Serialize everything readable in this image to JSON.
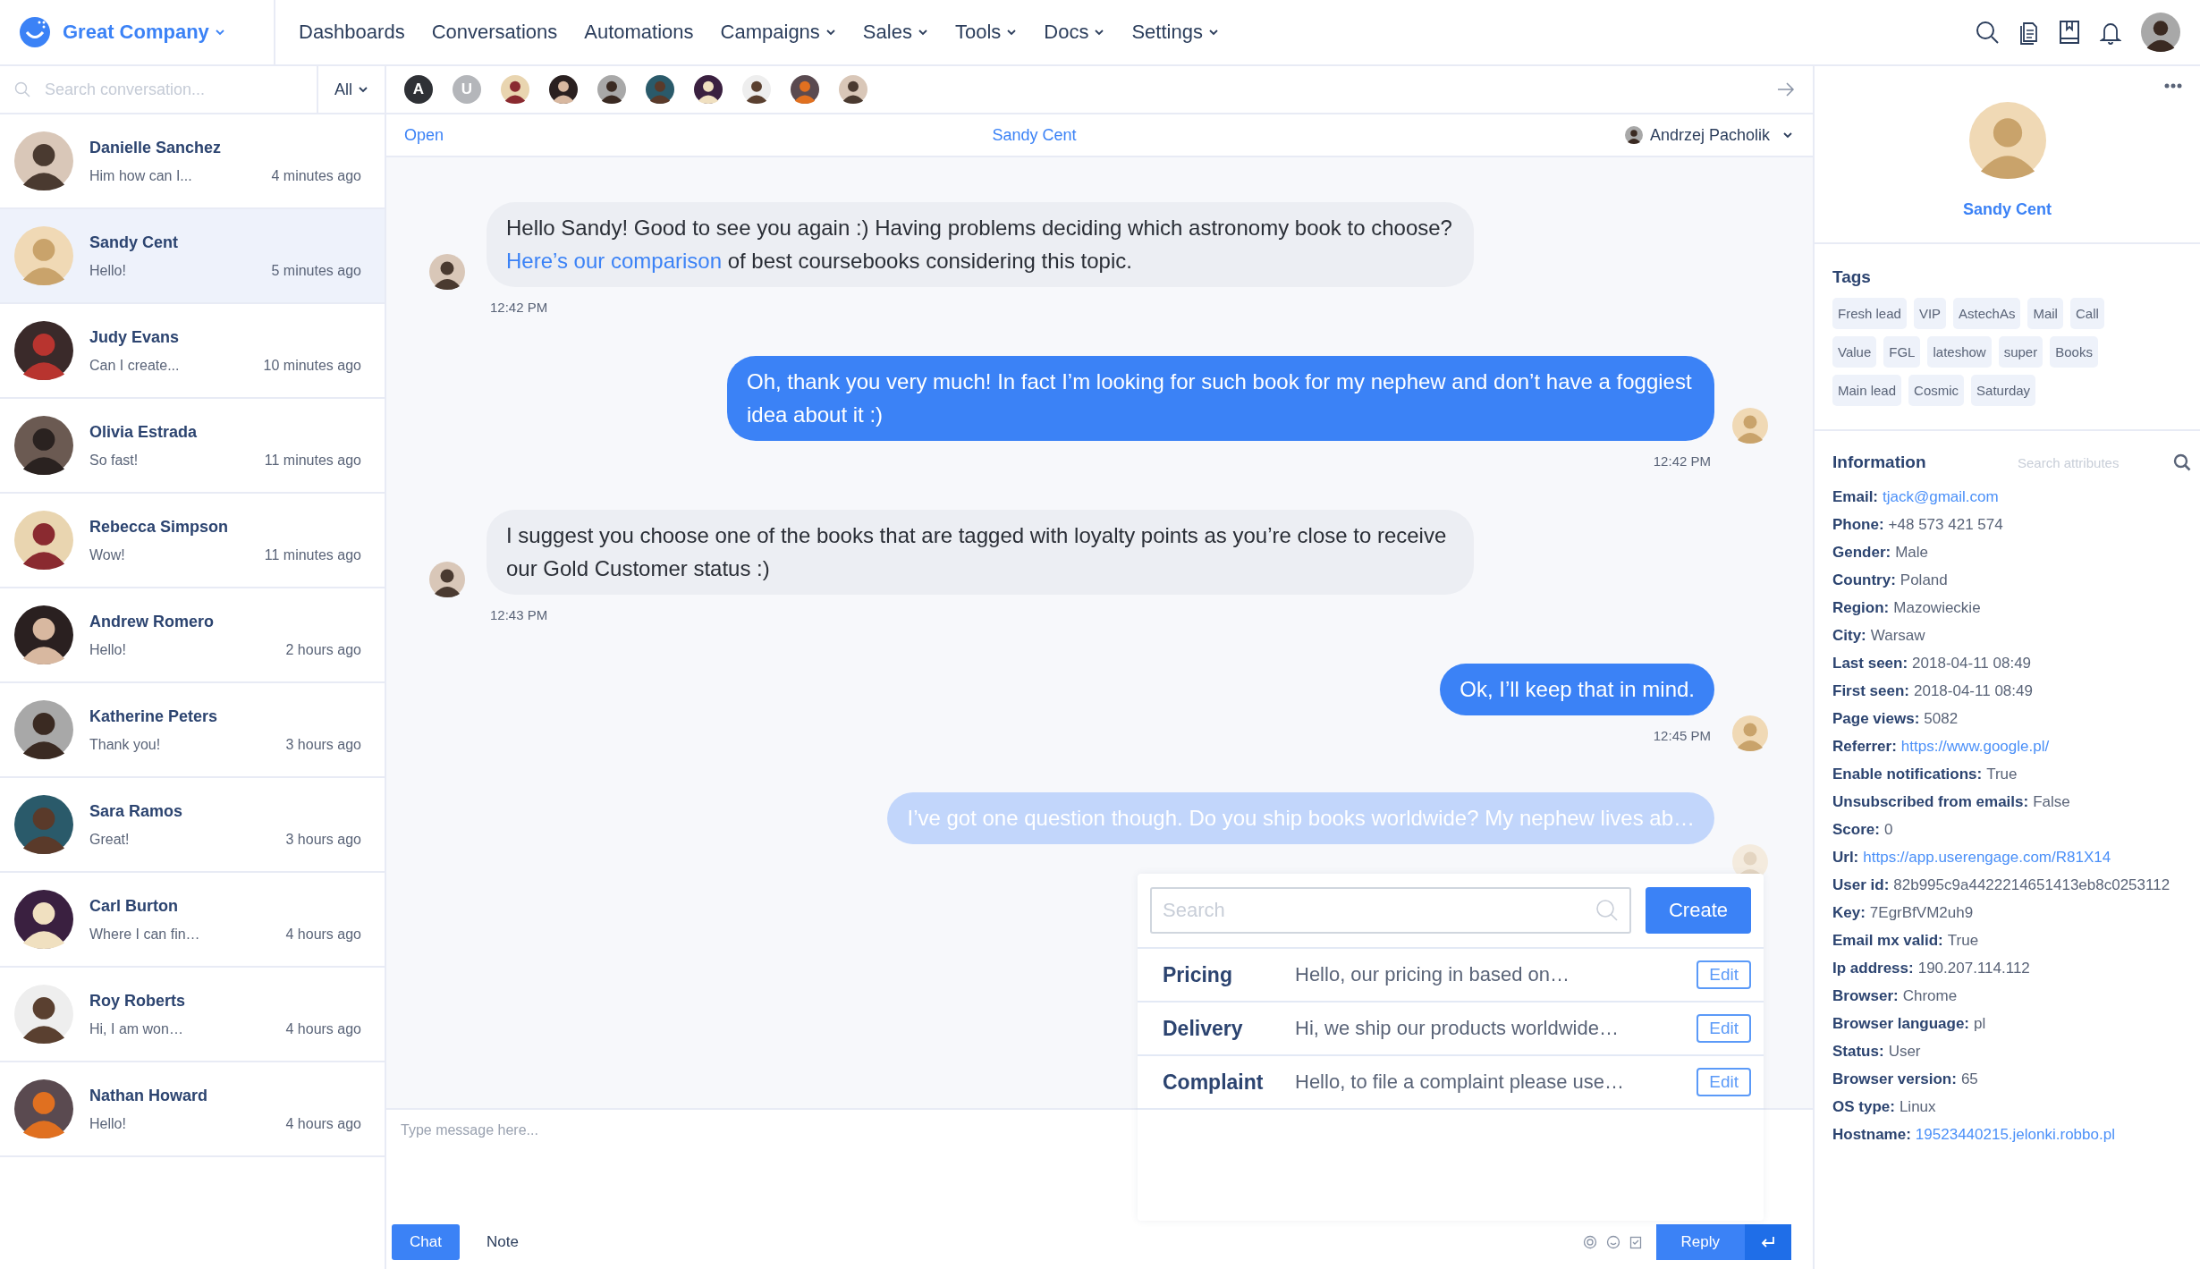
{
  "brand": {
    "name": "Great Company"
  },
  "nav": [
    {
      "label": "Dashboards",
      "dropdown": false
    },
    {
      "label": "Conversations",
      "dropdown": false
    },
    {
      "label": "Automations",
      "dropdown": false
    },
    {
      "label": "Campaigns",
      "dropdown": true
    },
    {
      "label": "Sales",
      "dropdown": true
    },
    {
      "label": "Tools",
      "dropdown": true
    },
    {
      "label": "Docs",
      "dropdown": true
    },
    {
      "label": "Settings",
      "dropdown": true
    }
  ],
  "sidebar": {
    "search": {
      "placeholder": "Search conversation..."
    },
    "filter": "All",
    "conversations": [
      {
        "name": "Danielle Sanchez",
        "preview": "Him how can I...",
        "time": "4 minutes ago",
        "selected": false
      },
      {
        "name": "Sandy Cent",
        "preview": "Hello!",
        "time": "5 minutes ago",
        "selected": true
      },
      {
        "name": "Judy Evans",
        "preview": "Can I create...",
        "time": "10 minutes ago",
        "selected": false
      },
      {
        "name": "Olivia Estrada",
        "preview": "So fast!",
        "time": "11 minutes ago",
        "selected": false
      },
      {
        "name": "Rebecca Simpson",
        "preview": "Wow!",
        "time": "11 minutes ago",
        "selected": false
      },
      {
        "name": "Andrew Romero",
        "preview": "Hello!",
        "time": "2 hours ago",
        "selected": false
      },
      {
        "name": "Katherine Peters",
        "preview": "Thank you!",
        "time": "3 hours ago",
        "selected": false
      },
      {
        "name": "Sara Ramos",
        "preview": "Great!",
        "time": "3 hours ago",
        "selected": false
      },
      {
        "name": "Carl Burton",
        "preview": "Where I can fin…",
        "time": "4 hours ago",
        "selected": false
      },
      {
        "name": "Roy Roberts",
        "preview": "Hi, I am won…",
        "time": "4 hours ago",
        "selected": false
      },
      {
        "name": "Nathan Howard",
        "preview": "Hello!",
        "time": "4 hours ago",
        "selected": false
      }
    ]
  },
  "participants": [
    {
      "kind": "letter",
      "label": "A",
      "color": "#2f3136"
    },
    {
      "kind": "letter",
      "label": "U",
      "color": "#b4b6ba"
    },
    {
      "kind": "picture"
    },
    {
      "kind": "picture"
    },
    {
      "kind": "picture"
    },
    {
      "kind": "picture"
    },
    {
      "kind": "picture"
    },
    {
      "kind": "picture"
    },
    {
      "kind": "picture"
    },
    {
      "kind": "picture"
    }
  ],
  "conversation": {
    "status": "Open",
    "contact": "Sandy Cent",
    "assignee": "Andrzej Pacholik",
    "messages": [
      {
        "kind": "agent",
        "text": "Hello Sandy! Good to see you again :) Having problems deciding which astronomy book to choose? ",
        "link": "Here’s our comparison",
        "text_after": " of best coursebooks considering this topic.",
        "time": "12:42 PM",
        "pending": false
      },
      {
        "kind": "customer",
        "text": "Oh, thank you very much! In fact I’m looking for such book for my nephew and don’t have a foggiest idea about it :)",
        "time": "12:42 PM",
        "pending": false
      },
      {
        "kind": "agent",
        "text": "I suggest you choose one of the books that are tagged with loyalty points as you’re close to receive our Gold Customer status :)",
        "time": "12:43 PM",
        "pending": false
      },
      {
        "kind": "customer",
        "text": "Ok, I’ll keep that in mind.",
        "time": "12:45 PM",
        "pending": false
      },
      {
        "kind": "customer",
        "text": "I’ve got one question though. Do you ship books worldwide? My nephew lives ab…",
        "pending": true
      }
    ]
  },
  "composer": {
    "placeholder": "Type message here...",
    "tabs": [
      {
        "label": "Chat",
        "selected": true
      },
      {
        "label": "Note",
        "selected": false
      }
    ],
    "reply": "Reply"
  },
  "canned_responses": {
    "search": {
      "placeholder": "Search"
    },
    "create": "Create",
    "items": [
      {
        "title": "Pricing",
        "snippet": "Hello, our pricing in based on…",
        "action": "Edit"
      },
      {
        "title": "Delivery",
        "snippet": "Hi, we ship our products worldwide…",
        "action": "Edit"
      },
      {
        "title": "Complaint",
        "snippet": "Hello, to file a complaint please use…",
        "action": "Edit"
      }
    ]
  },
  "profile": {
    "name": "Sandy Cent",
    "tags_title": "Tags",
    "tags": [
      "Fresh lead",
      "VIP",
      "AstechAs",
      "Mail",
      "Call",
      "Value",
      "FGL",
      "lateshow",
      "super",
      "Books",
      "Main lead",
      "Cosmic",
      "Saturday"
    ],
    "info_title": "Information",
    "info_search": {
      "placeholder": "Search attributes"
    },
    "info": [
      {
        "label": "Email:",
        "value": "tjack@gmail.com",
        "link": true
      },
      {
        "label": "Phone:",
        "value": "+48 573 421 574",
        "link": false
      },
      {
        "label": "Gender:",
        "value": "Male",
        "link": false
      },
      {
        "label": "Country:",
        "value": "Poland",
        "link": false
      },
      {
        "label": "Region:",
        "value": "Mazowieckie",
        "link": false
      },
      {
        "label": "City:",
        "value": "Warsaw",
        "link": false
      },
      {
        "label": "Last seen:",
        "value": "2018-04-11 08:49",
        "link": false
      },
      {
        "label": "First seen:",
        "value": "2018-04-11 08:49",
        "link": false
      },
      {
        "label": "Page views:",
        "value": "5082",
        "link": false
      },
      {
        "label": "Referrer:",
        "value": "https://www.google.pl/",
        "link": true
      },
      {
        "label": "Enable notifications:",
        "value": "True",
        "link": false
      },
      {
        "label": "Unsubscribed from emails:",
        "value": "False",
        "link": false
      },
      {
        "label": "Score:",
        "value": "0",
        "link": false
      },
      {
        "label": "Url:",
        "value": "https://app.userengage.com/R81X14",
        "link": true
      },
      {
        "label": "User id:",
        "value": "82b995c9a4422214651413eb8c0253112",
        "link": false
      },
      {
        "label": "Key:",
        "value": "7EgrBfVM2uh9",
        "link": false
      },
      {
        "label": "Email mx valid:",
        "value": "True",
        "link": false
      },
      {
        "label": "Ip address:",
        "value": "190.207.114.112",
        "link": false
      },
      {
        "label": "Browser:",
        "value": "Chrome",
        "link": false
      },
      {
        "label": "Browser language:",
        "value": "pl",
        "link": false
      },
      {
        "label": "Status:",
        "value": "User",
        "link": false
      },
      {
        "label": "Browser version:",
        "value": "65",
        "link": false
      },
      {
        "label": "OS type:",
        "value": "Linux",
        "link": false
      },
      {
        "label": "Hostname:",
        "value": "19523440215.jelonki.robbo.pl",
        "link": true
      }
    ]
  }
}
